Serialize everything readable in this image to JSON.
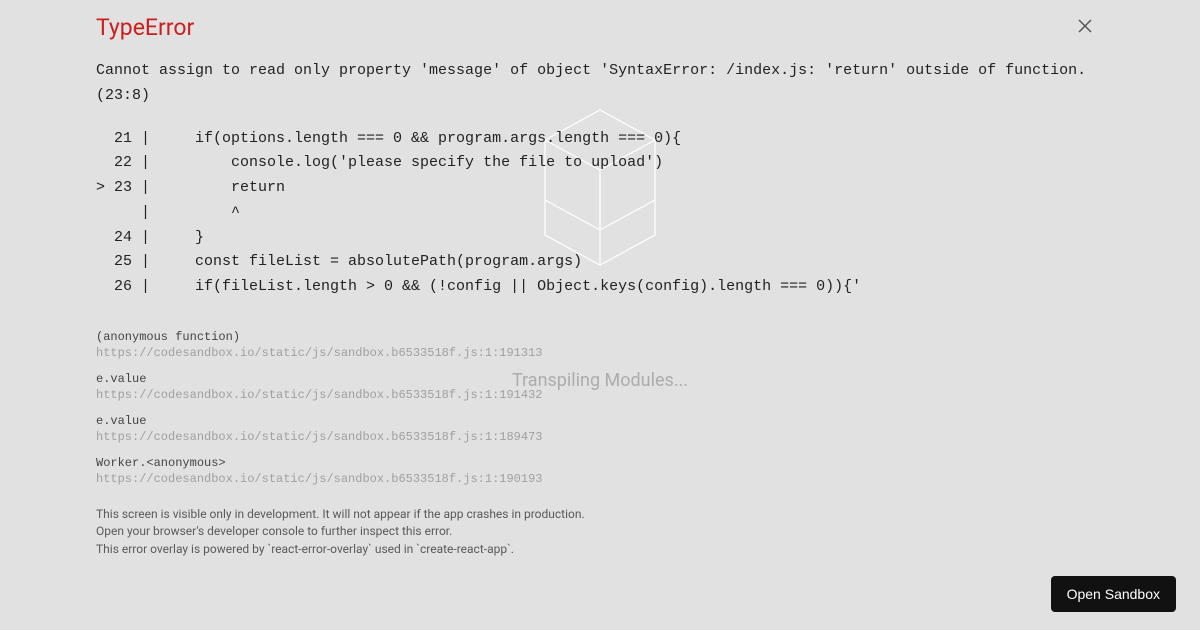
{
  "background": {
    "loading_text": "Transpiling Modules..."
  },
  "error": {
    "title": "TypeError",
    "message": "Cannot assign to read only property 'message' of object 'SyntaxError: /index.js: 'return' outside of function. (23:8)",
    "code_frame": "  21 |     if(options.length === 0 && program.args.length === 0){\n  22 |         console.log('please specify the file to upload')\n> 23 |         return\n     |         ^\n  24 |     }\n  25 |     const fileList = absolutePath(program.args)\n  26 |     if(fileList.length > 0 && (!config || Object.keys(config).length === 0)){'",
    "stack_trace": [
      {
        "name": "(anonymous function)",
        "location": "https://codesandbox.io/static/js/sandbox.b6533518f.js:1:191313"
      },
      {
        "name": "e.value",
        "location": "https://codesandbox.io/static/js/sandbox.b6533518f.js:1:191432"
      },
      {
        "name": "e.value",
        "location": "https://codesandbox.io/static/js/sandbox.b6533518f.js:1:189473"
      },
      {
        "name": "Worker.<anonymous>",
        "location": "https://codesandbox.io/static/js/sandbox.b6533518f.js:1:190193"
      }
    ],
    "footer_line1": "This screen is visible only in development. It will not appear if the app crashes in production.",
    "footer_line2": "Open your browser's developer console to further inspect this error.",
    "footer_line3": "This error overlay is powered by `react-error-overlay` used in `create-react-app`."
  },
  "actions": {
    "open_sandbox_label": "Open Sandbox"
  }
}
